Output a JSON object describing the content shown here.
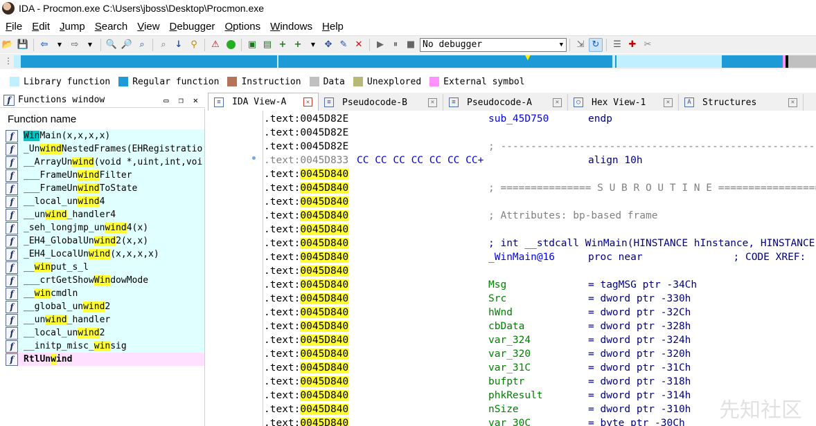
{
  "window": {
    "title": "IDA - Procmon.exe C:\\Users\\jboss\\Desktop\\Procmon.exe"
  },
  "menu": [
    {
      "label": "File",
      "ul": "F",
      "rest": "ile"
    },
    {
      "label": "Edit",
      "ul": "E",
      "rest": "dit"
    },
    {
      "label": "Jump",
      "ul": "J",
      "rest": "ump"
    },
    {
      "label": "Search",
      "ul": "S",
      "rest": "earch"
    },
    {
      "label": "View",
      "ul": "V",
      "rest": "iew"
    },
    {
      "label": "Debugger",
      "ul": "D",
      "rest": "ebugger"
    },
    {
      "label": "Options",
      "ul": "O",
      "rest": "ptions"
    },
    {
      "label": "Windows",
      "ul": "W",
      "rest": "indows"
    },
    {
      "label": "Help",
      "ul": "H",
      "rest": "elp"
    }
  ],
  "toolbar": {
    "debugger_select": "No debugger"
  },
  "legend": [
    {
      "label": "Library function",
      "color": "#c0f0ff"
    },
    {
      "label": "Regular function",
      "color": "#1e9bd6"
    },
    {
      "label": "Instruction",
      "color": "#b5735a"
    },
    {
      "label": "Data",
      "color": "#c0c0c0"
    },
    {
      "label": "Unexplored",
      "color": "#b8b878"
    },
    {
      "label": "External symbol",
      "color": "#ff90ff"
    }
  ],
  "functions_window": {
    "title": "Functions window",
    "column_header": "Function name",
    "items": [
      {
        "pre": "",
        "hl": "Win",
        "post": "Main(x,x,x,x)",
        "selected": true,
        "external": false
      },
      {
        "pre": "_Un",
        "hl": "wind",
        "post": "NestedFrames(EHRegistratio",
        "selected": false,
        "external": false
      },
      {
        "pre": "__ArrayUn",
        "hl": "wind",
        "post": "(void *,uint,int,voi",
        "selected": false,
        "external": false
      },
      {
        "pre": "___FrameUn",
        "hl": "wind",
        "post": "Filter",
        "selected": false,
        "external": false
      },
      {
        "pre": "___FrameUn",
        "hl": "wind",
        "post": "ToState",
        "selected": false,
        "external": false
      },
      {
        "pre": "__local_un",
        "hl": "wind",
        "post": "4",
        "selected": false,
        "external": false
      },
      {
        "pre": "__un",
        "hl": "wind",
        "post": "_handler4",
        "selected": false,
        "external": false
      },
      {
        "pre": "_seh_longjmp_un",
        "hl": "wind",
        "post": "4(x)",
        "selected": false,
        "external": false
      },
      {
        "pre": "_EH4_GlobalUn",
        "hl": "wind",
        "post": "2(x,x)",
        "selected": false,
        "external": false
      },
      {
        "pre": "_EH4_LocalUn",
        "hl": "wind",
        "post": "(x,x,x,x)",
        "selected": false,
        "external": false
      },
      {
        "pre": "__",
        "hl": "win",
        "post": "put_s_l",
        "selected": false,
        "external": false
      },
      {
        "pre": "___crtGetShow",
        "hl": "Win",
        "post": "dowMode",
        "selected": false,
        "external": false
      },
      {
        "pre": "__",
        "hl": "win",
        "post": "cmdln",
        "selected": false,
        "external": false
      },
      {
        "pre": "__global_un",
        "hl": "wind",
        "post": "2",
        "selected": false,
        "external": false
      },
      {
        "pre": "__un",
        "hl": "wind",
        "post": "_handler",
        "selected": false,
        "external": false
      },
      {
        "pre": "__local_un",
        "hl": "wind",
        "post": "2",
        "selected": false,
        "external": false
      },
      {
        "pre": "__initp_misc_",
        "hl": "win",
        "post": "sig",
        "selected": false,
        "external": false
      },
      {
        "pre": "RtlUn",
        "hl": "w",
        "post": "ind",
        "selected": false,
        "external": true
      }
    ]
  },
  "tabs": [
    {
      "label": "IDA View-A",
      "icon": "text-view-icon",
      "active": true
    },
    {
      "label": "Pseudocode-B",
      "icon": "pseudocode-icon",
      "active": false
    },
    {
      "label": "Pseudocode-A",
      "icon": "pseudocode-icon",
      "active": false
    },
    {
      "label": "Hex View-1",
      "icon": "hex-view-icon",
      "active": false
    },
    {
      "label": "Structures",
      "icon": "structures-icon",
      "active": false
    }
  ],
  "disasm": [
    {
      "addr": ".text:0045D82E",
      "hl": false,
      "grey": false,
      "bytes": "",
      "c2": "sub_45D750",
      "c2c": "blue",
      "c3": "endp",
      "c3c": "navy"
    },
    {
      "addr": ".text:0045D82E",
      "hl": false,
      "grey": false,
      "bytes": "",
      "c2": "",
      "c2c": "",
      "c3": "",
      "c3c": ""
    },
    {
      "addr": ".text:0045D82E",
      "hl": false,
      "grey": false,
      "bytes": "",
      "c2": "; ---------------------------------------------------------------------------",
      "c2c": "grey",
      "c3": "",
      "c3c": ""
    },
    {
      "addr": ".text:0045D833",
      "hl": false,
      "grey": true,
      "bytes": "CC CC CC CC CC CC CC+",
      "c2": "",
      "c2c": "",
      "c3": "align 10h",
      "c3c": "navy"
    },
    {
      "addr": ".text:0045D840",
      "hl": true,
      "grey": false,
      "bytes": "",
      "c2": "",
      "c2c": "",
      "c3": "",
      "c3c": ""
    },
    {
      "addr": ".text:0045D840",
      "hl": true,
      "grey": false,
      "bytes": "",
      "c2": "; =============== S U B R O U T I N E =======================================",
      "c2c": "grey",
      "c3": "",
      "c3c": ""
    },
    {
      "addr": ".text:0045D840",
      "hl": true,
      "grey": false,
      "bytes": "",
      "c2": "",
      "c2c": "",
      "c3": "",
      "c3c": ""
    },
    {
      "addr": ".text:0045D840",
      "hl": true,
      "grey": false,
      "bytes": "",
      "c2": "; Attributes: bp-based frame",
      "c2c": "grey",
      "c3": "",
      "c3c": ""
    },
    {
      "addr": ".text:0045D840",
      "hl": true,
      "grey": false,
      "bytes": "",
      "c2": "",
      "c2c": "",
      "c3": "",
      "c3c": ""
    },
    {
      "addr": ".text:0045D840",
      "hl": true,
      "grey": false,
      "bytes": "",
      "c2": "; int __stdcall WinMain(HINSTANCE hInstance, HINSTANCE hPrevInstance,",
      "c2c": "navy",
      "c3": "",
      "c3c": ""
    },
    {
      "addr": ".text:0045D840",
      "hl": true,
      "grey": false,
      "blueaddr": true,
      "bytes": "",
      "c2": "_WinMain@16",
      "c2c": "blue",
      "c3": "proc near               ; CODE XREF:",
      "c3c": "navy"
    },
    {
      "addr": ".text:0045D840",
      "hl": true,
      "grey": false,
      "bytes": "",
      "c2": "",
      "c2c": "",
      "c3": "",
      "c3c": ""
    },
    {
      "addr": ".text:0045D840",
      "hl": true,
      "grey": false,
      "bytes": "",
      "c2": "Msg",
      "c2c": "green",
      "c3": "= tagMSG ptr -34Ch",
      "c3c": "navy"
    },
    {
      "addr": ".text:0045D840",
      "hl": true,
      "grey": false,
      "bytes": "",
      "c2": "Src",
      "c2c": "green",
      "c3": "= dword ptr -330h",
      "c3c": "navy"
    },
    {
      "addr": ".text:0045D840",
      "hl": true,
      "grey": false,
      "bytes": "",
      "c2": "hWnd",
      "c2c": "green",
      "c3": "= dword ptr -32Ch",
      "c3c": "navy"
    },
    {
      "addr": ".text:0045D840",
      "hl": true,
      "grey": false,
      "bytes": "",
      "c2": "cbData",
      "c2c": "green",
      "c3": "= dword ptr -328h",
      "c3c": "navy"
    },
    {
      "addr": ".text:0045D840",
      "hl": true,
      "grey": false,
      "bytes": "",
      "c2": "var_324",
      "c2c": "green",
      "c3": "= dword ptr -324h",
      "c3c": "navy"
    },
    {
      "addr": ".text:0045D840",
      "hl": true,
      "grey": false,
      "bytes": "",
      "c2": "var_320",
      "c2c": "green",
      "c3": "= dword ptr -320h",
      "c3c": "navy"
    },
    {
      "addr": ".text:0045D840",
      "hl": true,
      "grey": false,
      "bytes": "",
      "c2": "var_31C",
      "c2c": "green",
      "c3": "= dword ptr -31Ch",
      "c3c": "navy"
    },
    {
      "addr": ".text:0045D840",
      "hl": true,
      "grey": false,
      "bytes": "",
      "c2": "bufptr",
      "c2c": "green",
      "c3": "= dword ptr -318h",
      "c3c": "navy"
    },
    {
      "addr": ".text:0045D840",
      "hl": true,
      "grey": false,
      "bytes": "",
      "c2": "phkResult",
      "c2c": "green",
      "c3": "= dword ptr -314h",
      "c3c": "navy"
    },
    {
      "addr": ".text:0045D840",
      "hl": true,
      "grey": false,
      "bytes": "",
      "c2": "nSize",
      "c2c": "green",
      "c3": "= dword ptr -310h",
      "c3c": "navy"
    },
    {
      "addr": ".text:0045D840",
      "hl": true,
      "grey": false,
      "bytes": "",
      "c2": "var_30C",
      "c2c": "green",
      "c3": "= byte ptr -30Ch",
      "c3c": "navy"
    }
  ],
  "watermark": "先知社区"
}
